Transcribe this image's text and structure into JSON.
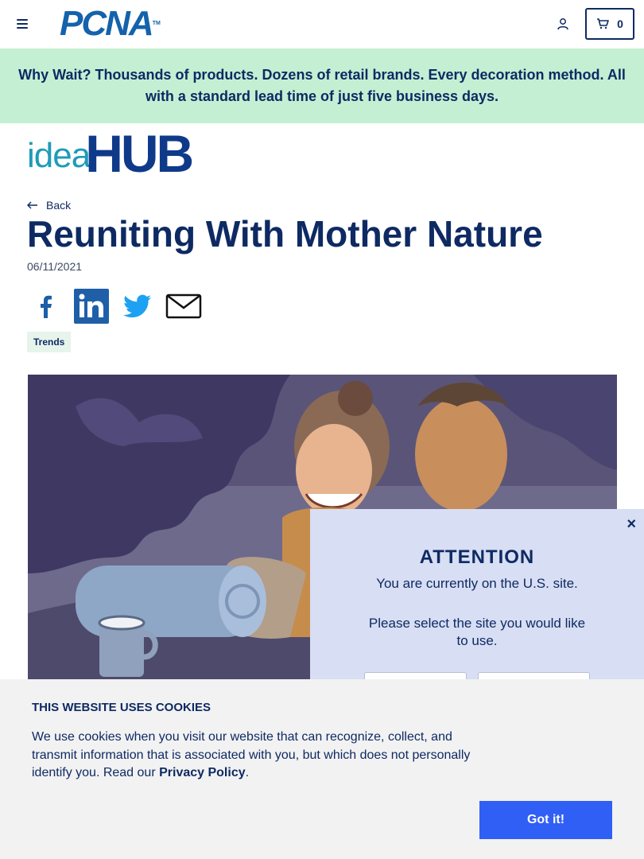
{
  "header": {
    "logo_text": "PCNA",
    "logo_tm": "TM",
    "cart_count": "0"
  },
  "promo": {
    "text": "Why Wait? Thousands of products. Dozens of retail brands. Every decoration method. All with a standard lead time of just five business days."
  },
  "ideahub": {
    "idea": "idea",
    "hub": "HUB"
  },
  "article": {
    "back_label": "Back",
    "title": "Reuniting With Mother Nature",
    "date": "06/11/2021",
    "tag": "Trends"
  },
  "attention": {
    "title": "ATTENTION",
    "line1": "You are currently on the U.S. site.",
    "line2": "Please select the site you would like to use.",
    "close": "×"
  },
  "cookie": {
    "heading": "THIS WEBSITE USES COOKIES",
    "text": "We use cookies when you visit our website that can recognize, collect, and transmit information that is associated with you, but which does not personally identify you. Read our ",
    "link": "Privacy Policy",
    "period": ".",
    "button": "Got it!"
  },
  "colors": {
    "navy": "#0e2a63",
    "promo_bg": "#c5efd3",
    "button_blue": "#2f5ff5",
    "modal_bg": "#d8def3"
  },
  "icons": [
    "menu-icon",
    "account-icon",
    "cart-icon",
    "arrow-left-icon",
    "facebook-icon",
    "linkedin-icon",
    "twitter-icon",
    "email-icon",
    "close-icon"
  ]
}
